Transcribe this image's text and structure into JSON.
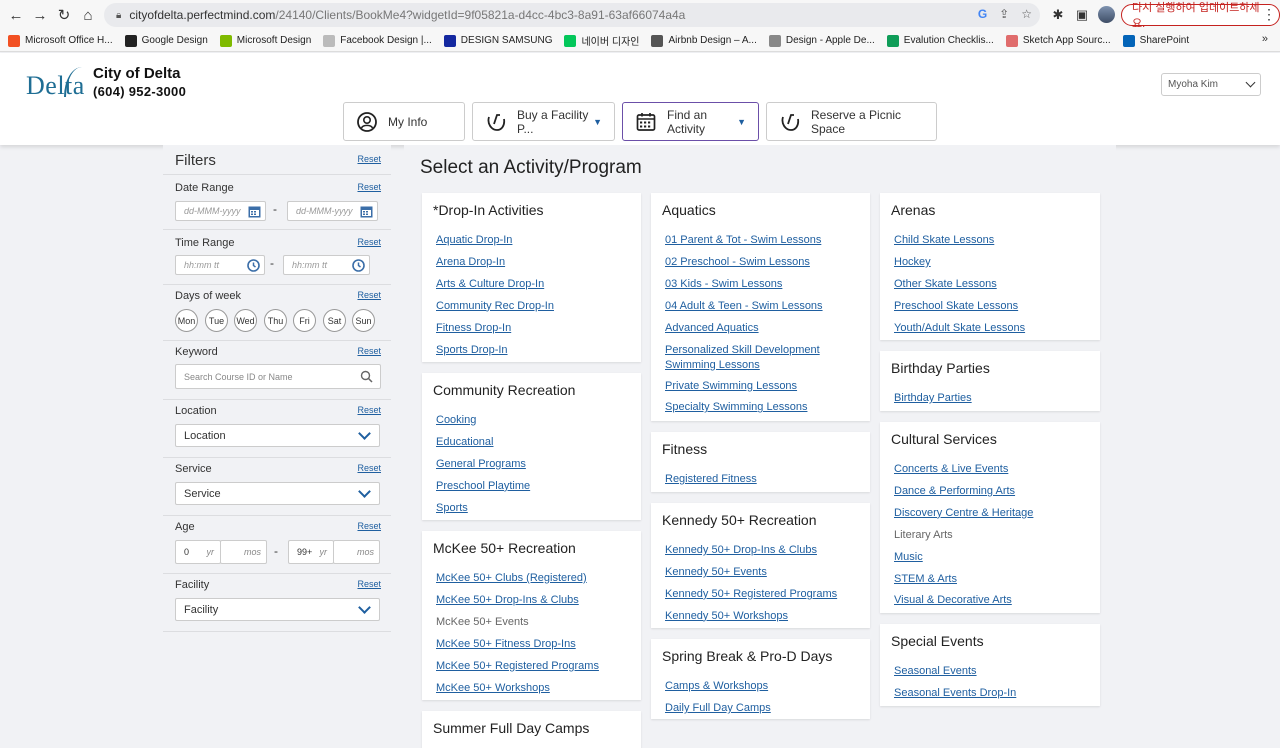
{
  "browser": {
    "url_domain": "cityofdelta.perfectmind.com",
    "url_path": "/24140/Clients/BookMe4?widgetId=9f05821a-d4cc-4bc3-8a91-63af66074a4a",
    "update_button": "다시 실행하여 업데이트하세요.",
    "bookmarks": [
      {
        "label": "Microsoft Office H...",
        "color": "#f25022"
      },
      {
        "label": "Google Design",
        "color": "#222222"
      },
      {
        "label": "Microsoft Design",
        "color": "#7fba00"
      },
      {
        "label": "Facebook Design |...",
        "color": "#bbbbbb"
      },
      {
        "label": "DESIGN SAMSUNG",
        "color": "#1428a0"
      },
      {
        "label": "네이버 디자인",
        "color": "#03c75a"
      },
      {
        "label": "Airbnb Design – A...",
        "color": "#555555"
      },
      {
        "label": "Design - Apple De...",
        "color": "#888888"
      },
      {
        "label": "Evalution Checklis...",
        "color": "#0f9d58"
      },
      {
        "label": "Sketch App Sourc...",
        "color": "#e06c6c"
      },
      {
        "label": "SharePoint",
        "color": "#0364b8"
      }
    ]
  },
  "header": {
    "logo_text": "Delta",
    "city_name": "City of Delta",
    "phone": "(604) 952-3000",
    "user": "Myoha Kim",
    "tabs": [
      {
        "label": "My Info",
        "caret": ""
      },
      {
        "label": "Buy a Facility P...",
        "caret": "▼"
      },
      {
        "label": "Find an Activity",
        "caret": "▼"
      },
      {
        "label": "Reserve a Picnic Space",
        "caret": ""
      }
    ]
  },
  "filters": {
    "title": "Filters",
    "reset": "Reset",
    "date_range": {
      "label": "Date Range",
      "from_placeholder": "dd-MMM-yyyy",
      "to_placeholder": "dd-MMM-yyyy"
    },
    "time_range": {
      "label": "Time Range",
      "from_placeholder": "hh:mm tt",
      "to_placeholder": "hh:mm tt"
    },
    "days_of_week": {
      "label": "Days of week",
      "days": [
        "Mon",
        "Tue",
        "Wed",
        "Thu",
        "Fri",
        "Sat",
        "Sun"
      ]
    },
    "keyword": {
      "label": "Keyword",
      "placeholder": "Search Course ID or Name"
    },
    "location": {
      "label": "Location",
      "value": "Location"
    },
    "service": {
      "label": "Service",
      "value": "Service"
    },
    "age": {
      "label": "Age",
      "min_yr": "0",
      "min_mos": "",
      "max_yr": "99+",
      "max_mos": "",
      "yr_unit": "yr",
      "mos_unit": "mos"
    },
    "facility": {
      "label": "Facility",
      "value": "Facility"
    }
  },
  "main": {
    "title": "Select an Activity/Program",
    "cards": {
      "dropin": {
        "title": "*Drop-In Activities",
        "items": [
          "Aquatic Drop-In",
          "Arena Drop-In",
          "Arts & Culture Drop-In",
          "Community Rec Drop-In",
          "Fitness Drop-In",
          "Sports Drop-In"
        ]
      },
      "community": {
        "title": "Community Recreation",
        "items": [
          "Cooking",
          "Educational",
          "General Programs",
          "Preschool Playtime",
          "Sports"
        ]
      },
      "mckee": {
        "title": "McKee 50+ Recreation",
        "items": [
          "McKee 50+ Clubs (Registered)",
          "McKee 50+ Drop-Ins & Clubs",
          "McKee 50+ Events",
          "McKee 50+ Fitness Drop-Ins",
          "McKee 50+ Registered Programs",
          "McKee 50+ Workshops"
        ]
      },
      "summer": {
        "title": "Summer Full Day Camps",
        "items": []
      },
      "aquatics": {
        "title": "Aquatics",
        "items": [
          "01 Parent & Tot - Swim Lessons",
          "02 Preschool - Swim Lessons",
          "03 Kids - Swim Lessons",
          "04 Adult & Teen - Swim Lessons",
          "Advanced Aquatics",
          "Personalized Skill Development Swimming Lessons",
          "Private Swimming Lessons",
          "Specialty Swimming Lessons"
        ]
      },
      "fitness": {
        "title": "Fitness",
        "items": [
          "Registered Fitness"
        ]
      },
      "kennedy": {
        "title": "Kennedy 50+ Recreation",
        "items": [
          "Kennedy 50+ Drop-Ins & Clubs",
          "Kennedy 50+ Events",
          "Kennedy 50+ Registered Programs",
          "Kennedy 50+ Workshops"
        ]
      },
      "spring": {
        "title": "Spring Break & Pro-D Days",
        "items": [
          "Camps & Workshops",
          "Daily Full Day Camps"
        ]
      },
      "arenas": {
        "title": "Arenas",
        "items": [
          "Child Skate Lessons",
          "Hockey",
          "Other Skate Lessons",
          "Preschool Skate Lessons",
          "Youth/Adult Skate Lessons"
        ]
      },
      "birthday": {
        "title": "Birthday Parties",
        "items": [
          "Birthday Parties"
        ]
      },
      "cultural": {
        "title": "Cultural Services",
        "items": [
          "Concerts & Live Events",
          "Dance & Performing Arts",
          "Discovery Centre & Heritage",
          "Literary Arts",
          "Music",
          "STEM & Arts",
          "Visual & Decorative Arts"
        ]
      },
      "special": {
        "title": "Special Events",
        "items": [
          "Seasonal Events",
          "Seasonal Events Drop-In"
        ]
      }
    },
    "disabled_items": [
      "McKee 50+ Events",
      "Literary Arts"
    ],
    "wrap_items": [
      "Personalized Skill Development Swimming Lessons"
    ]
  }
}
